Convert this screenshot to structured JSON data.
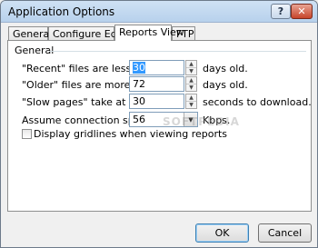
{
  "window": {
    "title": "Application Options",
    "help_label": "?",
    "close_label": "✕"
  },
  "tabs": [
    {
      "label": "General",
      "active": false
    },
    {
      "label": "Configure Editors",
      "active": false
    },
    {
      "label": "Reports View",
      "active": true
    },
    {
      "label": "FTP",
      "active": false
    }
  ],
  "group": {
    "title": "General"
  },
  "fields": {
    "recent": {
      "label": "\"Recent\" files are less than",
      "value": "30",
      "suffix": "days old."
    },
    "older": {
      "label": "\"Older\" files are more than",
      "value": "72",
      "suffix": "days old."
    },
    "slow": {
      "label": "\"Slow pages\" take at least",
      "value": "30",
      "suffix": "seconds to download."
    },
    "speed": {
      "label": "Assume connection speed of",
      "value": "56",
      "suffix": "Kbps."
    }
  },
  "gridlines": {
    "label": "Display gridlines when viewing reports",
    "checked": false
  },
  "watermark": "SOFTPEDIA",
  "buttons": {
    "ok": "OK",
    "cancel": "Cancel"
  }
}
